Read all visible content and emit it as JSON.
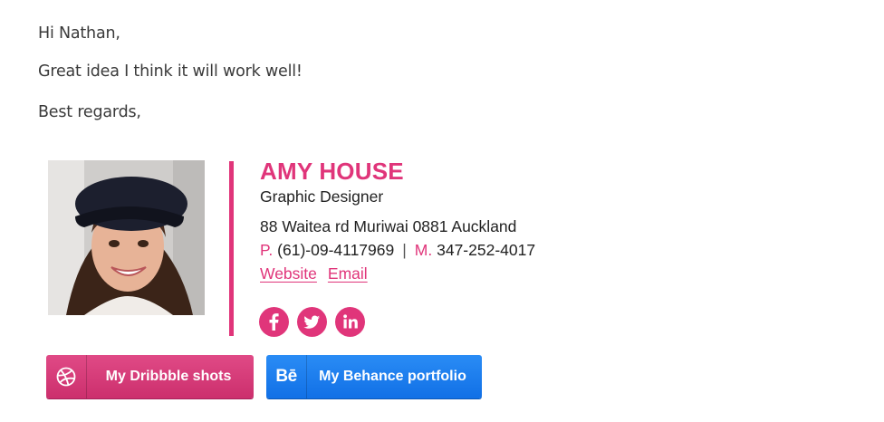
{
  "email": {
    "greeting": "Hi Nathan,",
    "body": "Great idea I think it will work well!",
    "closing": "Best regards,"
  },
  "signature": {
    "name": "AMY HOUSE",
    "title": "Graphic Designer",
    "address": "88 Waitea rd Muriwai 0881 Auckland",
    "phone_label": "P.",
    "phone": "(61)-09-4117969",
    "separator": "|",
    "mobile_label": "M.",
    "mobile": "347-252-4017",
    "links": {
      "website": "Website",
      "email": "Email"
    },
    "social": [
      "facebook-icon",
      "twitter-icon",
      "linkedin-icon"
    ],
    "accent_color": "#e0357a"
  },
  "buttons": {
    "dribbble": {
      "label": "My Dribbble shots",
      "color": "#d63a78",
      "icon": "dribbble-icon"
    },
    "behance": {
      "label": "My Behance portfolio",
      "color": "#1a7df0",
      "icon_text": "Bē"
    }
  }
}
